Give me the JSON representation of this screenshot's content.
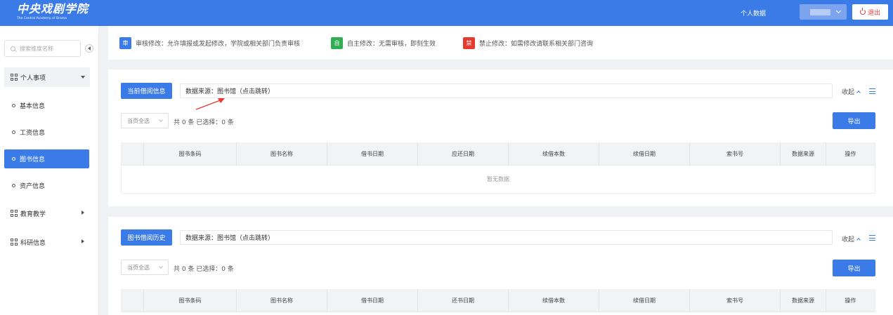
{
  "header": {
    "logo_cn": "中央戏剧学院",
    "logo_en": "The Central Academy of Drama",
    "personal_data": "个人数据",
    "logout": "退出"
  },
  "sidebar": {
    "search_placeholder": "搜索维度名称",
    "groups": [
      {
        "label": "个人事项",
        "expanded": true
      },
      {
        "label": "教育教学",
        "expanded": false
      },
      {
        "label": "科研信息",
        "expanded": false
      }
    ],
    "items": [
      {
        "label": "基本信息",
        "active": false
      },
      {
        "label": "工资信息",
        "active": false
      },
      {
        "label": "图书信息",
        "active": true
      },
      {
        "label": "资产信息",
        "active": false
      }
    ]
  },
  "legend": [
    {
      "badge": "审",
      "color": "#3b7be8",
      "text": "审核修改：允许填报或发起修改，学院或相关部门负责审核"
    },
    {
      "badge": "自",
      "color": "#2fae53",
      "text": "自主修改：无需审核，即刻生效"
    },
    {
      "badge": "禁",
      "color": "#e63a2e",
      "text": "禁止修改：如需修改请联系相关部门咨询"
    }
  ],
  "panels": [
    {
      "title": "当前借阅信息",
      "source": "数据来源：图书馆（点击跳转）",
      "collapse": "收起",
      "page_select": "当页全选",
      "count": "共 0 条   已选择：0 条",
      "export": "导出",
      "columns": [
        "",
        "图书条码",
        "图书名称",
        "借书日期",
        "应还日期",
        "续借本数",
        "续借日期",
        "索书号",
        "数据来源",
        "操作"
      ],
      "empty": "暂无数据"
    },
    {
      "title": "图书借阅历史",
      "source": "数据来源：图书馆（点击跳转）",
      "collapse": "收起",
      "page_select": "当页全选",
      "count": "共 0 条   已选择：0 条",
      "export": "导出",
      "columns": [
        "",
        "图书条码",
        "图书名称",
        "借书日期",
        "还书日期",
        "续借本数",
        "续借日期",
        "索书号",
        "数据来源",
        "操作"
      ]
    }
  ],
  "colors": {
    "primary": "#3b7be8",
    "arrow": "#e53935"
  }
}
